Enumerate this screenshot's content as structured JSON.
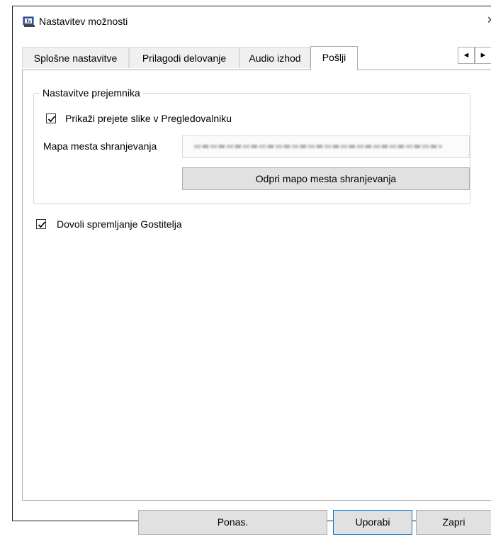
{
  "window": {
    "title": "Nastavitev možnosti",
    "close_glyph": "×"
  },
  "tabs": [
    {
      "label": "Splošne nastavitve",
      "active": false
    },
    {
      "label": "Prilagodi delovanje",
      "active": false
    },
    {
      "label": "Audio izhod",
      "active": false
    },
    {
      "label": "Pošlji",
      "active": true
    }
  ],
  "tab_scroll": {
    "left_glyph": "◄",
    "right_glyph": "►"
  },
  "receiver_group": {
    "legend": "Nastavitve prejemnika",
    "show_received_checkbox": {
      "label": "Prikaži prejete slike v Pregledovalniku",
      "checked": true
    },
    "save_folder": {
      "label": "Mapa mesta shranjevanja",
      "value": ""
    },
    "open_folder_button": "Odpri mapo mesta shranjevanja"
  },
  "allow_host_save_checkbox": {
    "label": "Dovoli spremljanje Gostitelja",
    "checked": true
  },
  "footer": {
    "reset_button": "Ponas.",
    "apply_button": "Uporabi",
    "close_button": "Zapri"
  },
  "colors": {
    "accent": "#0078d7",
    "button_face": "#e1e1e1",
    "border": "#adadad"
  }
}
